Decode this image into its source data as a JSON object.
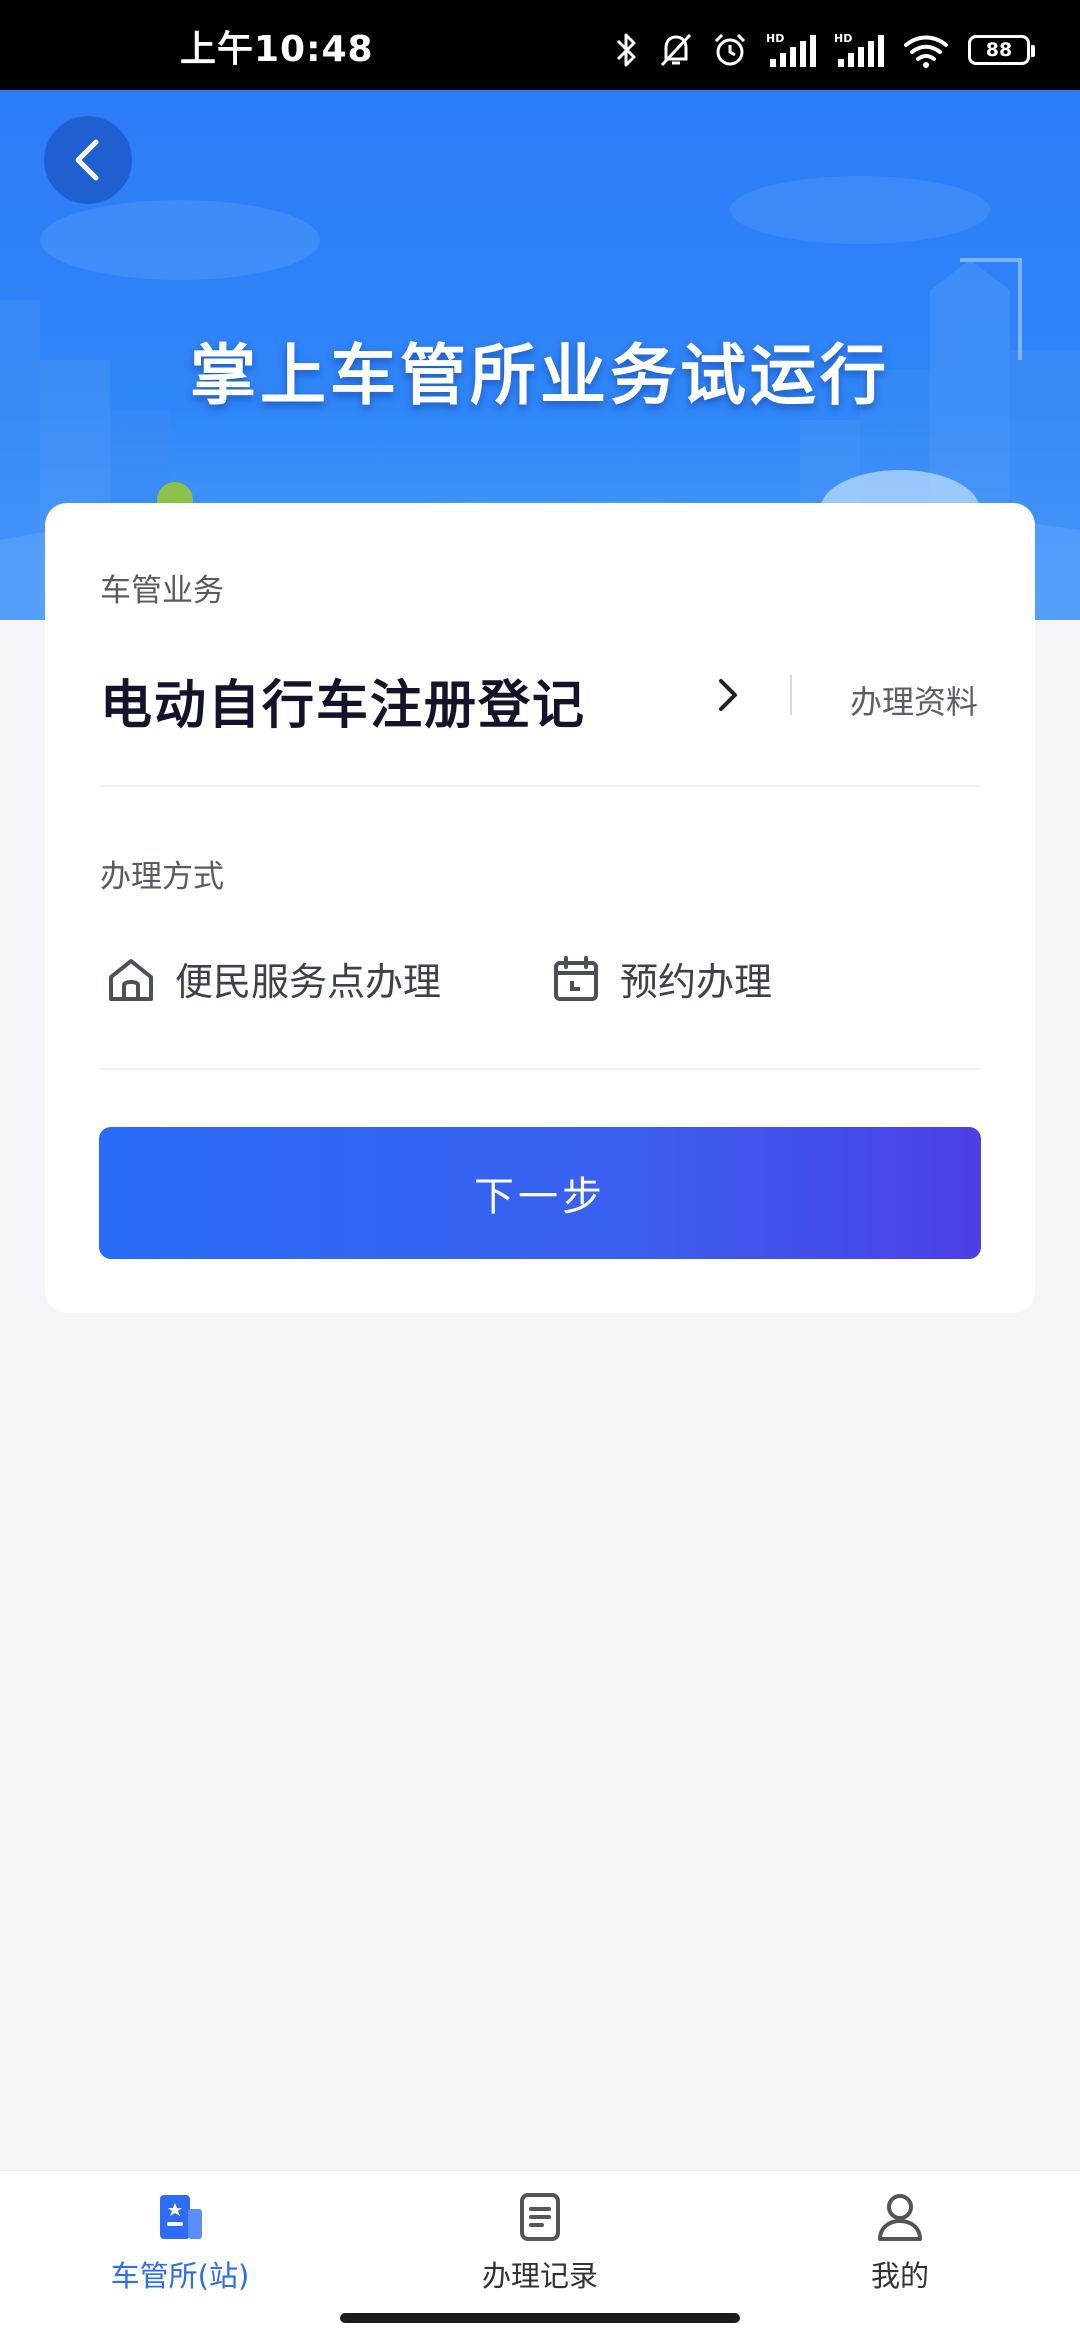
{
  "status_bar": {
    "time": "上午10:48",
    "hd1": "HD",
    "hd2": "HD",
    "battery": "88"
  },
  "banner": {
    "title": "掌上车管所业务试运行"
  },
  "card": {
    "service_label": "车管业务",
    "service_name": "电动自行车注册登记",
    "materials_link": "办理资料",
    "method_label": "办理方式",
    "methods": [
      {
        "label": "便民服务点办理",
        "icon": "home-icon"
      },
      {
        "label": "预约办理",
        "icon": "calendar-icon"
      }
    ],
    "next_button": "下一步"
  },
  "bottom_nav": {
    "items": [
      {
        "label": "车管所(站)",
        "icon": "station-icon",
        "active": true
      },
      {
        "label": "办理记录",
        "icon": "record-icon",
        "active": false
      },
      {
        "label": "我的",
        "icon": "user-icon",
        "active": false
      }
    ]
  },
  "colors": {
    "accent": "#2e6cf3",
    "banner": "#2f86f8",
    "button_start": "#2a6cf8",
    "button_end": "#4b3fe6"
  }
}
